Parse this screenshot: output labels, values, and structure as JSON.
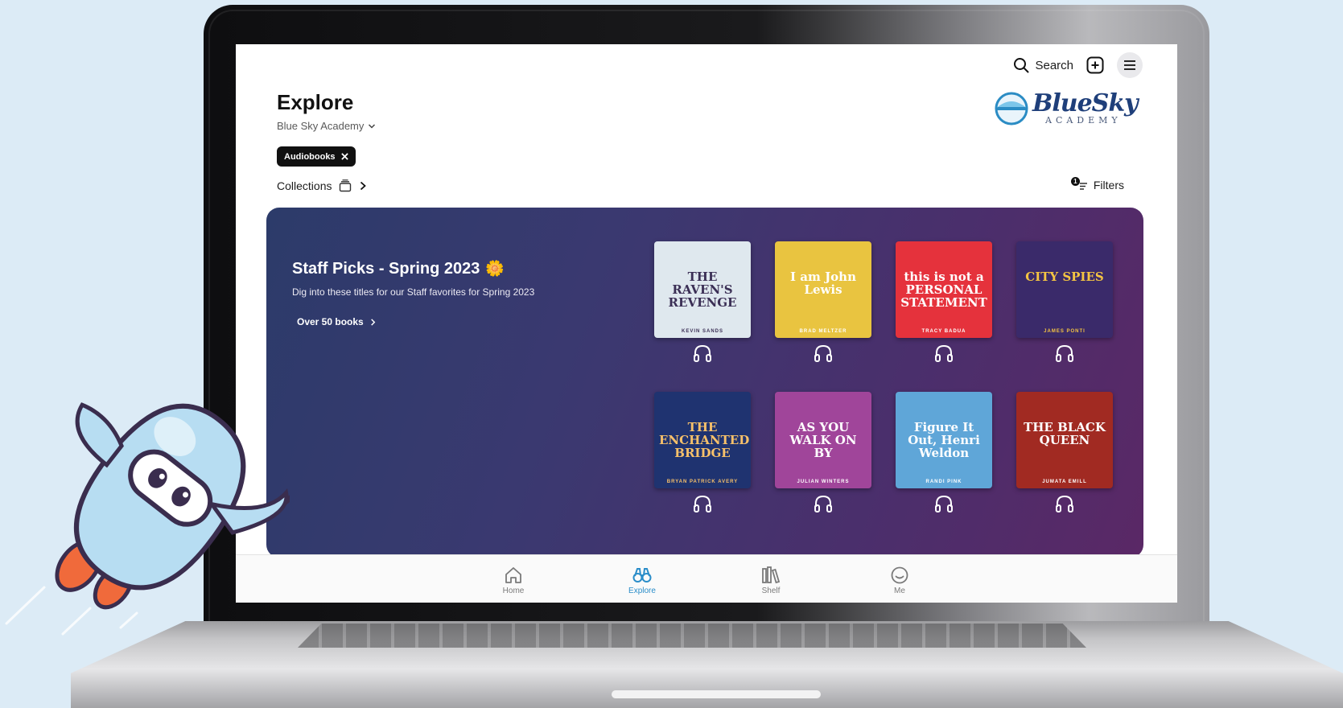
{
  "topbar": {
    "search_label": "Search",
    "icons": [
      "search-icon",
      "plus-square-icon",
      "hamburger-menu-icon"
    ]
  },
  "header": {
    "title": "Explore",
    "school": "Blue Sky Academy"
  },
  "logo": {
    "wordmark": "BlueSky",
    "subtitle": "ACADEMY"
  },
  "filter_chip": {
    "label": "Audiobooks"
  },
  "collections": {
    "label": "Collections"
  },
  "filters": {
    "label": "Filters",
    "count": "1"
  },
  "banner": {
    "title": "Staff Picks - Spring 2023",
    "emoji": "🌼",
    "description": "Dig into these titles for our Staff favorites for Spring 2023",
    "link_label": "Over 50 books",
    "books": [
      {
        "title": "THE RAVEN'S REVENGE",
        "author": "KEVIN SANDS",
        "bg": "#dfe8ee",
        "fg": "#3b2f55"
      },
      {
        "title": "I am John Lewis",
        "author": "BRAD MELTZER",
        "bg": "#e9c440",
        "fg": "#ffffff"
      },
      {
        "title": "this is not a PERSONAL STATEMENT",
        "author": "TRACY BADUA",
        "bg": "#e5323c",
        "fg": "#ffffff"
      },
      {
        "title": "CITY SPIES",
        "author": "JAMES PONTI",
        "bg": "#3a2a6a",
        "fg": "#f5c542"
      },
      {
        "title": "THE ENCHANTED BRIDGE",
        "author": "BRYAN PATRICK AVERY",
        "bg": "#1f3370",
        "fg": "#f7c16a"
      },
      {
        "title": "AS YOU WALK ON BY",
        "author": "JULIAN WINTERS",
        "bg": "#a0459a",
        "fg": "#ffffff"
      },
      {
        "title": "Figure It Out, Henri Weldon",
        "author": "RANDI PINK",
        "bg": "#5fa6d8",
        "fg": "#ffffff"
      },
      {
        "title": "THE BLACK QUEEN",
        "author": "JUMATA EMILL",
        "bg": "#a12a22",
        "fg": "#ffffff"
      }
    ]
  },
  "bottom_nav": {
    "items": [
      {
        "label": "Home",
        "icon": "home-icon"
      },
      {
        "label": "Explore",
        "icon": "binoculars-icon",
        "active": true
      },
      {
        "label": "Shelf",
        "icon": "shelf-icon"
      },
      {
        "label": "Me",
        "icon": "smiley-icon"
      }
    ]
  },
  "colors": {
    "background": "#dcebf6",
    "banner_start": "#2c3b6a",
    "banner_end": "#5a2866",
    "accent": "#2a8dc9"
  }
}
